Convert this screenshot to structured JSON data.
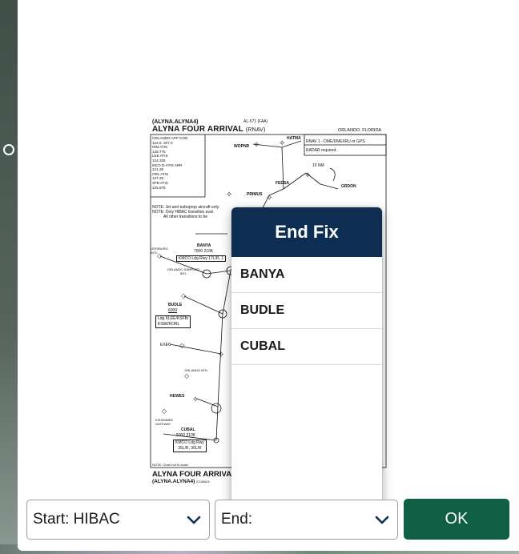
{
  "chart": {
    "id_line": "(ALYNA.ALYNA4)",
    "id_code": "24035",
    "faa_code": "AL-571 (FAA)",
    "title": "ALYNA FOUR ARRIVAL",
    "title_suffix": "(RNAV)",
    "city": "ORLANDO, FLORIDA",
    "frequencies": "ORLANDO APP CON\n124.8  307.0\nISM ATIS\n128.775\nLEE ATIS\n124.325\nMCO D-ATIS ARR\n121.25\nORL ATIS\n127.25\nSFB ATIS\n125.975",
    "rnav_req": "RNAV 1 - DME/DME/IRU or GPS.",
    "radar_req": "RADAR required.",
    "note1": "NOTE: Jet and turboprop aircraft only.",
    "note2": "NOTE: Only HIBAC transition avai",
    "note3": "All other transitions to be",
    "fixes": {
      "wopnr": "WOPNR",
      "hatma": "HATMA",
      "fedsa": "FEDSA",
      "grdon": "GRDON",
      "primus": "PRIMUS",
      "banya": "BANYA",
      "budle": "BUDLE",
      "cubal": "CUBAL",
      "hewes": "HEWES",
      "leesburg": "LEESBURG INTL",
      "orlando_sanford": "ORLANDO SANFORD INTL",
      "exec": "EXEC",
      "orlando_intl": "ORLANDO INTL",
      "kissimmee": "KISSIMMEE GATEWAY"
    },
    "banya_restr": "7000  210K",
    "banya_rwy": "KMCO Ldg Rwy 17L/R, 1",
    "budle_alt": "6000",
    "budle_box1": "Ldg KLEE/KSFB/",
    "budle_box2": "KISM/KORL",
    "cubal_restr": "5000  210K",
    "cubal_rwy1": "KMCO Ldg Rwy",
    "cubal_rwy2": "35L/R, 36L/R",
    "nm_label": "10 NM",
    "not_to_scale": "NOTE: Chart not to scale.",
    "footer_title": "ALYNA FOUR ARRIVAL",
    "footer_id": "(ALYNA.ALYNA4)",
    "footer_code": "23JAN24"
  },
  "popover": {
    "title": "End Fix",
    "items": [
      "BANYA",
      "BUDLE",
      "CUBAL"
    ]
  },
  "bottom": {
    "start_label": "Start: HIBAC",
    "end_label": "End:",
    "ok_label": "OK"
  },
  "colors": {
    "header_navy": "#0d2d52",
    "ok_green": "#0f5f45"
  }
}
